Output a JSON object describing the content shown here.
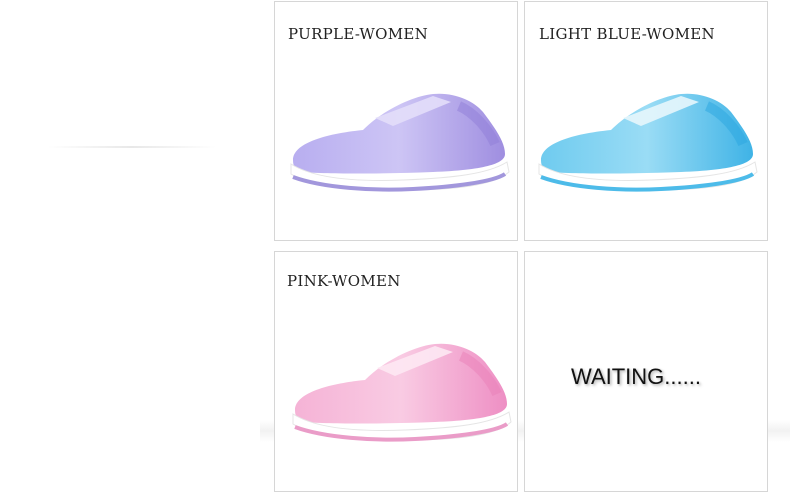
{
  "tiles": [
    {
      "label": "PURPLE-WOMEN",
      "color": "#a99ae8"
    },
    {
      "label": "LIGHT BLUE-WOMEN",
      "color": "#5cc3ec"
    },
    {
      "label": "PINK-WOMEN",
      "color": "#f2a3cf"
    },
    {
      "label": "WAITING......"
    }
  ]
}
